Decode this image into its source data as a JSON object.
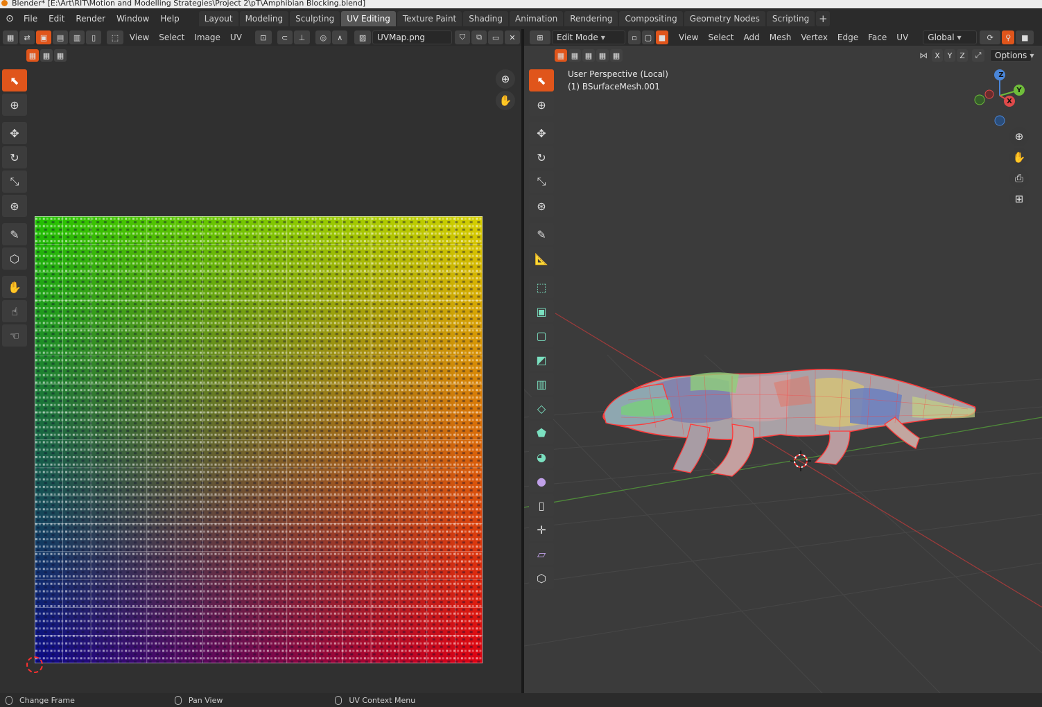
{
  "window": {
    "title": "Blender* [E:\\Art\\RIT\\Motion and Modelling Strategies\\Project 2\\pT\\Amphibian Blocking.blend]"
  },
  "topbar": {
    "menus": [
      "File",
      "Edit",
      "Render",
      "Window",
      "Help"
    ],
    "workspaces": [
      "Layout",
      "Modeling",
      "Sculpting",
      "UV Editing",
      "Texture Paint",
      "Shading",
      "Animation",
      "Rendering",
      "Compositing",
      "Geometry Nodes",
      "Scripting"
    ],
    "active_workspace": "UV Editing",
    "add_label": "+"
  },
  "uv_editor": {
    "menus": [
      "View",
      "Select",
      "Image",
      "UV"
    ],
    "image_name": "UVMap.png",
    "grid_label_chars": "0123456789ABCDEF",
    "grid_row_chars": "ABCDEFGHIJKLMNOPQRSTUVWXYZ"
  },
  "viewport": {
    "mode": "Edit Mode",
    "menus": [
      "View",
      "Select",
      "Add",
      "Mesh",
      "Vertex",
      "Edge",
      "Face",
      "UV"
    ],
    "orientation": "Global",
    "options_label": "Options",
    "axis_labels": [
      "X",
      "Y",
      "Z"
    ],
    "overlay_line1": "User Perspective (Local)",
    "overlay_line2": "(1) BSurfaceMesh.001",
    "colors": {
      "mesh_edge": "#ff3a3a",
      "grid_x": "#9c3b3b",
      "grid_y": "#4f8a3a"
    }
  },
  "statusbar": {
    "items": [
      "Change Frame",
      "Pan View",
      "UV Context Menu"
    ]
  }
}
